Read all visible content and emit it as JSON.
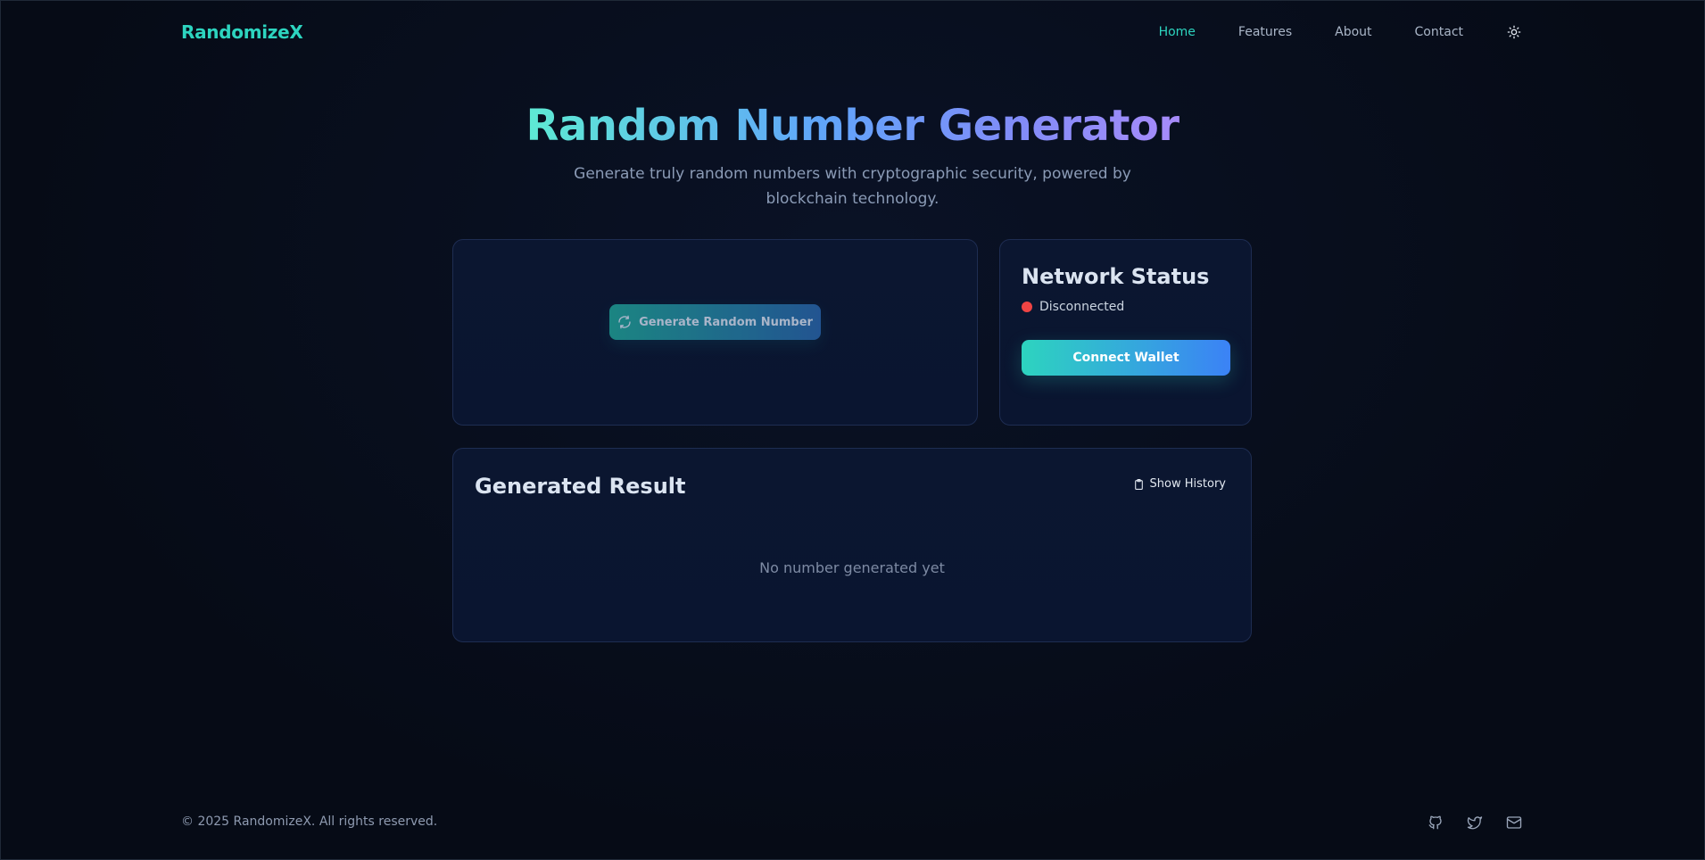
{
  "nav": {
    "brand": "RandomizeX",
    "links": [
      "Home",
      "Features",
      "About",
      "Contact"
    ],
    "active_index": 0,
    "theme_icon": "sun-icon"
  },
  "hero": {
    "title": "Random Number Generator",
    "subtitle": "Generate truly random numbers with cryptographic security, powered by blockchain technology."
  },
  "generator": {
    "button_label": "Generate Random Number",
    "button_icon": "refresh-icon",
    "disabled": true
  },
  "network": {
    "title": "Network Status",
    "status": "Disconnected",
    "status_color": "#ef4444",
    "connect_label": "Connect Wallet"
  },
  "result": {
    "title": "Generated Result",
    "history_label": "Show History",
    "history_icon": "clipboard-icon",
    "empty_text": "No number generated yet"
  },
  "footer": {
    "copyright": "© 2025 RandomizeX. All rights reserved.",
    "icons": [
      "github-icon",
      "twitter-icon",
      "mail-icon"
    ]
  },
  "colors": {
    "accent": "#2dd4bf",
    "accent_blue": "#3b82f6",
    "background": "#070d1a",
    "card": "#0b1630"
  }
}
